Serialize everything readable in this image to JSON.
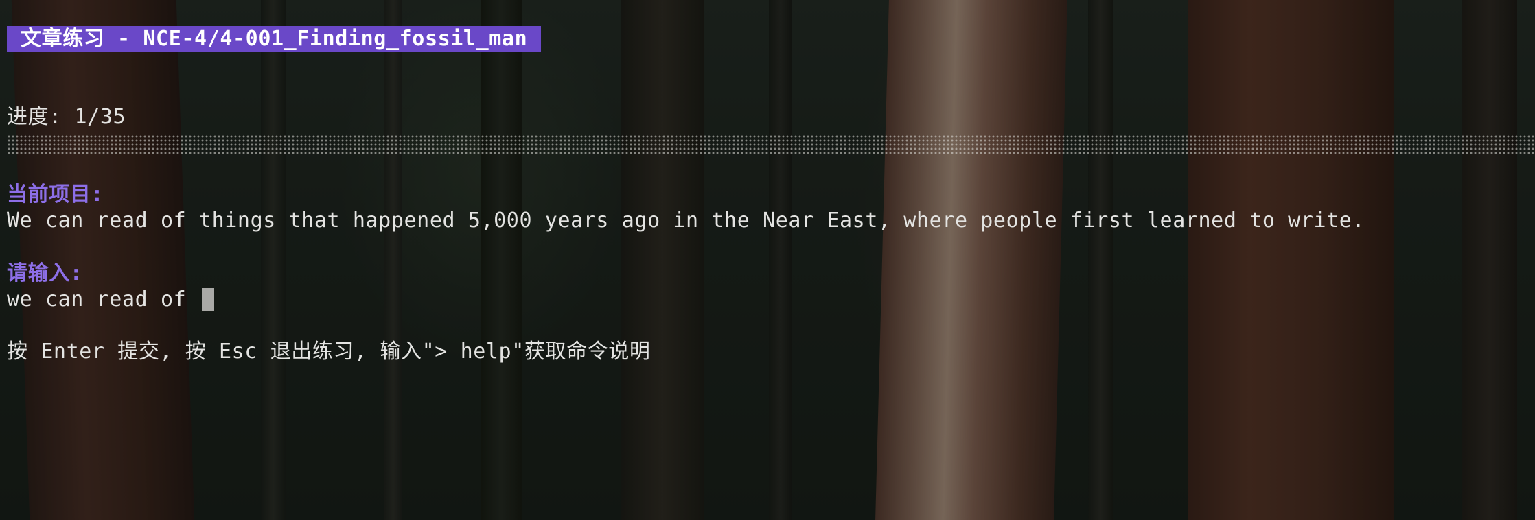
{
  "header": {
    "title": "文章练习 - NCE-4/4-001_Finding_fossil_man"
  },
  "progress": {
    "text": "进度: 1/35",
    "current": 1,
    "total": 35
  },
  "current_item": {
    "label": "当前项目:",
    "text": "We can read of things that happened 5,000 years ago in the Near East, where people first learned to write."
  },
  "input": {
    "label": "请输入:",
    "value": "we can read of "
  },
  "hint": {
    "text": "按 Enter 提交, 按 Esc 退出练习, 输入\"> help\"获取命令说明"
  },
  "colors": {
    "accent": "#6a48c8",
    "label": "#8d6fe8",
    "text": "#e4e4e2",
    "cursor": "#a9a9a6"
  },
  "icons": {
    "cursor": "block-cursor"
  }
}
